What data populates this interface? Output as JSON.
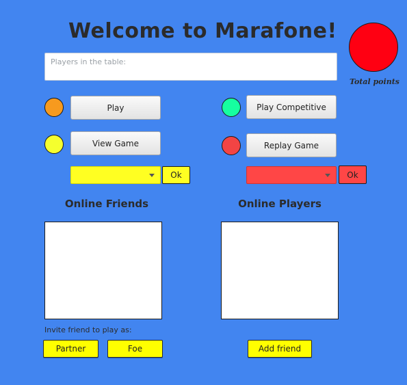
{
  "title": "Welcome to Marafone!",
  "total_points": {
    "label": "Total points",
    "color": "#ff0012"
  },
  "players_table": {
    "placeholder": "Players in the table:"
  },
  "modes": {
    "play": {
      "label": "Play",
      "dot_color": "#f79a1e"
    },
    "play_competitive": {
      "label": "Play Competitive",
      "dot_color": "#16ffa0"
    },
    "view_game": {
      "label": "View Game",
      "dot_color": "#f5ff2e",
      "select_color": "#ffff22",
      "ok_label": "Ok"
    },
    "replay_game": {
      "label": "Replay Game",
      "dot_color": "#f34444",
      "select_color": "#ff4646",
      "ok_label": "Ok"
    }
  },
  "online_friends": {
    "heading": "Online Friends"
  },
  "online_players": {
    "heading": "Online Players"
  },
  "invite": {
    "label": "Invite friend to play as:",
    "partner_label": "Partner",
    "foe_label": "Foe"
  },
  "add_friend_label": "Add friend"
}
